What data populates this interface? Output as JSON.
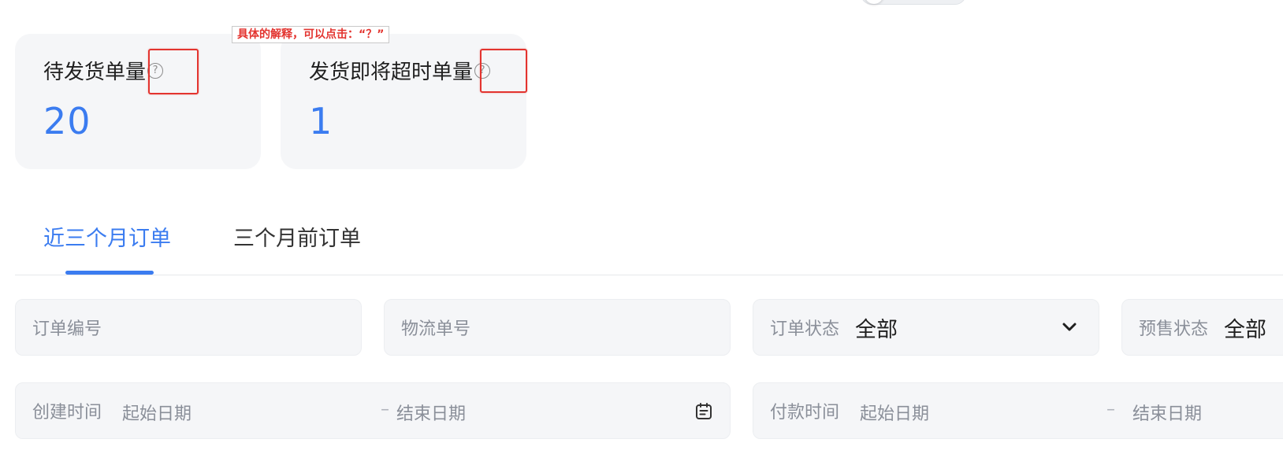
{
  "annotation": {
    "tooltip_text": "具体的解释，可以点击：“？”"
  },
  "stats": [
    {
      "label": "待发货单量",
      "value": "20",
      "help_glyph": "?"
    },
    {
      "label": "发货即将超时单量",
      "value": "1",
      "help_glyph": "?"
    }
  ],
  "tabs": [
    {
      "label": "近三个月订单",
      "active": true
    },
    {
      "label": "三个月前订单",
      "active": false
    }
  ],
  "filters": {
    "order_no": {
      "placeholder": "订单编号"
    },
    "logistics_no": {
      "placeholder": "物流单号"
    },
    "order_status": {
      "label": "订单状态",
      "value": "全部"
    },
    "presale_status": {
      "label": "预售状态",
      "value": "全部"
    },
    "create_time": {
      "label": "创建时间",
      "start_placeholder": "起始日期",
      "separator": "–",
      "end_placeholder": "结束日期"
    },
    "pay_time": {
      "label": "付款时间",
      "start_placeholder": "起始日期",
      "separator": "–",
      "end_placeholder": "结束日期"
    }
  },
  "colors": {
    "accent": "#3b7cf0",
    "annotation": "#e3342f",
    "card_bg": "#f5f6f8"
  },
  "icons": {
    "help": "question-circle-icon",
    "dropdown": "chevron-down-icon",
    "calendar": "calendar-icon"
  }
}
